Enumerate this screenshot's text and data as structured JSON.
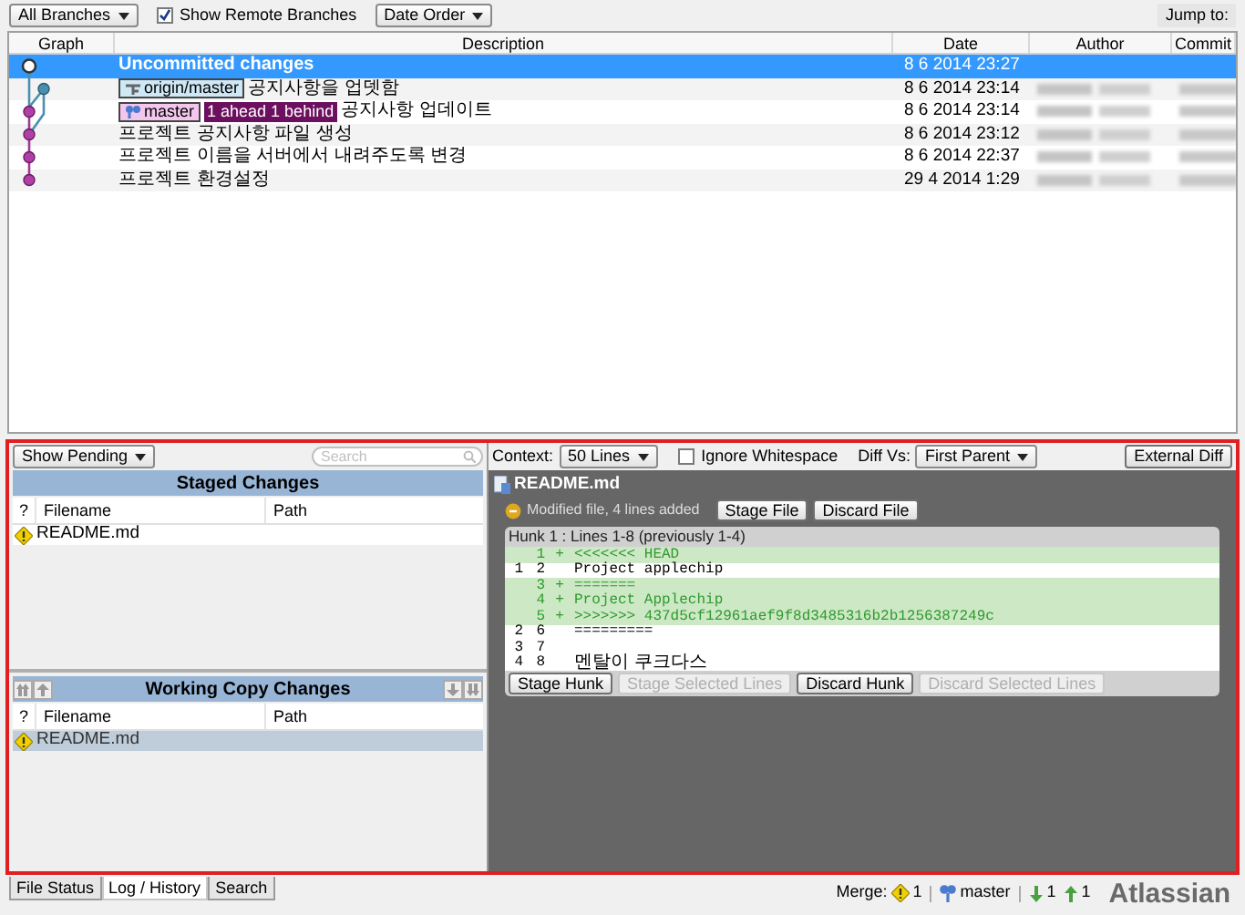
{
  "toolbar": {
    "branches": "All Branches",
    "show_remote": {
      "label": "Show Remote Branches",
      "checked": true
    },
    "order": "Date Order",
    "jump_to": "Jump to:"
  },
  "history": {
    "columns": [
      "Graph",
      "Description",
      "Date",
      "Author",
      "Commit"
    ],
    "rows": [
      {
        "description": "Uncommitted changes",
        "date": "8 6 2014 23:27",
        "selected": true,
        "refs": []
      },
      {
        "description": "공지사항을 업뎃함",
        "date": "8 6 2014 23:14",
        "selected": false,
        "refs": [
          {
            "kind": "remote",
            "label": "origin/master"
          }
        ]
      },
      {
        "description": "공지사항 업데이트",
        "date": "8 6 2014 23:14",
        "selected": false,
        "refs": [
          {
            "kind": "local",
            "label": "master",
            "status": "1 ahead 1 behind"
          }
        ]
      },
      {
        "description": "프로젝트 공지사항 파일 생성",
        "date": "8 6 2014 23:12",
        "selected": false,
        "refs": []
      },
      {
        "description": "프로젝트 이름을 서버에서 내려주도록 변경",
        "date": "8 6 2014 22:37",
        "selected": false,
        "refs": []
      },
      {
        "description": "프로젝트 환경설정",
        "date": "29 4 2014 1:29",
        "selected": false,
        "refs": []
      }
    ]
  },
  "file_pane": {
    "filter": "Show Pending",
    "search_placeholder": "Search",
    "staged": {
      "title": "Staged Changes",
      "columns": [
        "?",
        "Filename",
        "Path"
      ],
      "files": [
        {
          "name": "README.md",
          "selected": false
        }
      ]
    },
    "working": {
      "title": "Working Copy Changes",
      "columns": [
        "?",
        "Filename",
        "Path"
      ],
      "files": [
        {
          "name": "README.md",
          "selected": true
        }
      ]
    }
  },
  "diff": {
    "context_label": "Context:",
    "context": "50 Lines",
    "ignore_whitespace": {
      "label": "Ignore Whitespace",
      "checked": false
    },
    "diff_vs_label": "Diff Vs:",
    "diff_vs": "First Parent",
    "external": "External Diff",
    "file": "README.md",
    "summary": "Modified file, 4 lines added",
    "stage_file": "Stage File",
    "discard_file": "Discard File",
    "hunk_title": "Hunk 1 : Lines 1-8 (previously 1-4)",
    "lines": [
      {
        "kind": "added",
        "new": "1",
        "sign": "+",
        "text": "<<<<<<< HEAD"
      },
      {
        "kind": "context",
        "old": "1",
        "new": "2",
        "text": "Project applechip"
      },
      {
        "kind": "added",
        "new": "3",
        "sign": "+",
        "text": "======="
      },
      {
        "kind": "added",
        "new": "4",
        "sign": "+",
        "text": "Project Applechip"
      },
      {
        "kind": "added",
        "new": "5",
        "sign": "+",
        "text": ">>>>>>> 437d5cf12961aef9f8d3485316b2b1256387249c"
      },
      {
        "kind": "context",
        "old": "2",
        "new": "6",
        "text": "========="
      },
      {
        "kind": "context",
        "old": "3",
        "new": "7"
      },
      {
        "kind": "context",
        "old": "4",
        "new": "8",
        "text": "멘탈이 쿠크다스"
      }
    ],
    "hunk_buttons": [
      {
        "label": "Stage Hunk",
        "disabled": false
      },
      {
        "label": "Stage Selected Lines",
        "disabled": true
      },
      {
        "label": "Discard Hunk",
        "disabled": false
      },
      {
        "label": "Discard Selected Lines",
        "disabled": true
      }
    ]
  },
  "tabs": [
    {
      "label": "File Status",
      "selected": false
    },
    {
      "label": "Log / History",
      "selected": true
    },
    {
      "label": "Search",
      "selected": false
    }
  ],
  "status": {
    "merge_label": "Merge:",
    "conflicts": "1",
    "branch": "master",
    "behind": "1",
    "ahead": "1",
    "brand": "Atlassian"
  }
}
